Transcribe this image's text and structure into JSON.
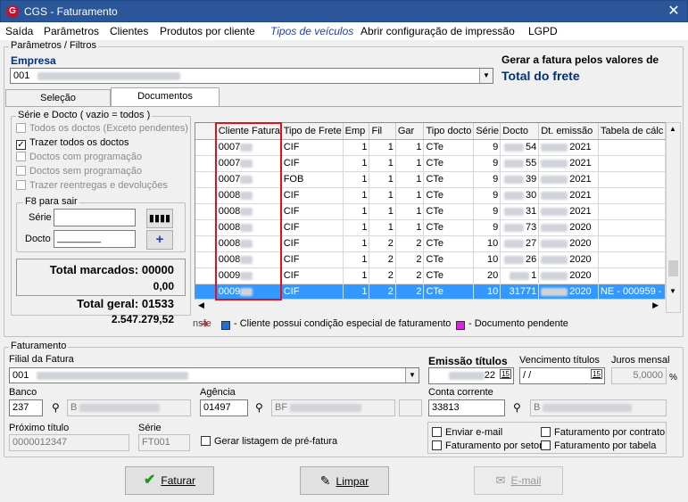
{
  "window": {
    "title": "CGS - Faturamento",
    "close": "✕"
  },
  "menu": [
    "Saída",
    "Parâmetros",
    "Clientes",
    "Produtos por cliente",
    "Tipos de veículos",
    "Abrir configuração de impressão",
    "LGPD"
  ],
  "params": {
    "group_label": "Parâmetros / Filtros",
    "empresa_label": "Empresa",
    "empresa_value": "001",
    "gerar_label": "Gerar a fatura pelos valores de",
    "gerar_value": "Total do frete"
  },
  "tabs": [
    "Seleção",
    "Documentos"
  ],
  "serie": {
    "group_label": "Série e Docto  ( vazio = todos )",
    "checks": [
      {
        "label": "Todos os doctos (Exceto pendentes)",
        "checked": false,
        "disabled": true
      },
      {
        "label": "Trazer todos os doctos",
        "checked": true,
        "disabled": false
      },
      {
        "label": "Doctos com programação",
        "checked": false,
        "disabled": true
      },
      {
        "label": "Doctos sem programação",
        "checked": false,
        "disabled": true
      },
      {
        "label": "Trazer reentregas e devoluções",
        "checked": false,
        "disabled": true
      }
    ],
    "f8_label": "F8 para sair",
    "serie_label": "Série",
    "docto_label": "Docto",
    "docto_value": "________"
  },
  "totals": {
    "marcados_label": "Total marcados: 00000",
    "marcados_value": "0,00",
    "geral_label": "Total geral: 01533",
    "geral_value": "2.547.279,52"
  },
  "grid": {
    "columns": [
      "Cliente Fatura",
      "Tipo de Frete",
      "Emp",
      "Fil",
      "Gar",
      "Tipo docto",
      "Série",
      "Docto",
      "Dt. emissão",
      "Tabela de cálc"
    ],
    "rows": [
      [
        "0007",
        "CIF",
        "1",
        "1",
        "1",
        "CTe",
        "9",
        "54",
        "2021",
        ""
      ],
      [
        "0007",
        "CIF",
        "1",
        "1",
        "1",
        "CTe",
        "9",
        "55",
        "2021",
        ""
      ],
      [
        "0007",
        "FOB",
        "1",
        "1",
        "1",
        "CTe",
        "9",
        "39",
        "2021",
        ""
      ],
      [
        "0008",
        "CIF",
        "1",
        "1",
        "1",
        "CTe",
        "9",
        "30",
        "2021",
        ""
      ],
      [
        "0008",
        "CIF",
        "1",
        "1",
        "1",
        "CTe",
        "9",
        "31",
        "2021",
        ""
      ],
      [
        "0008",
        "CIF",
        "1",
        "1",
        "1",
        "CTe",
        "9",
        "73",
        "2020",
        ""
      ],
      [
        "0008",
        "CIF",
        "1",
        "2",
        "2",
        "CTe",
        "10",
        "27",
        "2020",
        ""
      ],
      [
        "0008",
        "CIF",
        "1",
        "2",
        "2",
        "CTe",
        "10",
        "26",
        "2020",
        ""
      ],
      [
        "0009",
        "CIF",
        "1",
        "2",
        "2",
        "CTe",
        "20",
        "1",
        "2020",
        ""
      ],
      [
        "0009",
        "CIF",
        "1",
        "2",
        "2",
        "CTe",
        "10",
        "31771",
        "2020",
        "NE - 000959 -"
      ]
    ],
    "selected_row": 9
  },
  "legend": {
    "left": "nsfe",
    "blue": "- Cliente possui condição especial de faturamento",
    "magenta": "- Documento pendente"
  },
  "fat": {
    "group_label": "Faturamento",
    "filial_label": "Filial da Fatura",
    "filial_value": "001",
    "emissao_label": "Emissão títulos",
    "emissao_value": "22",
    "venc_label": "Vencimento títulos",
    "venc_value": "/ /",
    "juros_label": "Juros mensal",
    "juros_value": "5,0000",
    "pct": "%",
    "banco_label": "Banco",
    "banco_value": "237",
    "banco_name": "B",
    "agencia_label": "Agência",
    "agencia_value": "01497",
    "agencia_name": "BF",
    "conta_label": "Conta corrente",
    "conta_value": "33813",
    "conta_name": "B",
    "proximo_label": "Próximo título",
    "proximo_value": "0000012347",
    "serie_label": "Série",
    "serie_value": "FT001",
    "pre_label": "Gerar listagem de pré-fatura",
    "opts": [
      "Enviar e-mail",
      "Faturamento por contrato",
      "Faturamento por setor",
      "Faturamento por tabela"
    ]
  },
  "buttons": {
    "faturar": "Faturar",
    "limpar": "Limpar",
    "email": "E-mail"
  },
  "colors": {
    "title": "#2b579a",
    "selection": "#3399ff",
    "highlight": "#e0101c",
    "accent": "#00307a",
    "legend_blue": "#1e6fd6",
    "legend_magenta": "#e020e0"
  }
}
